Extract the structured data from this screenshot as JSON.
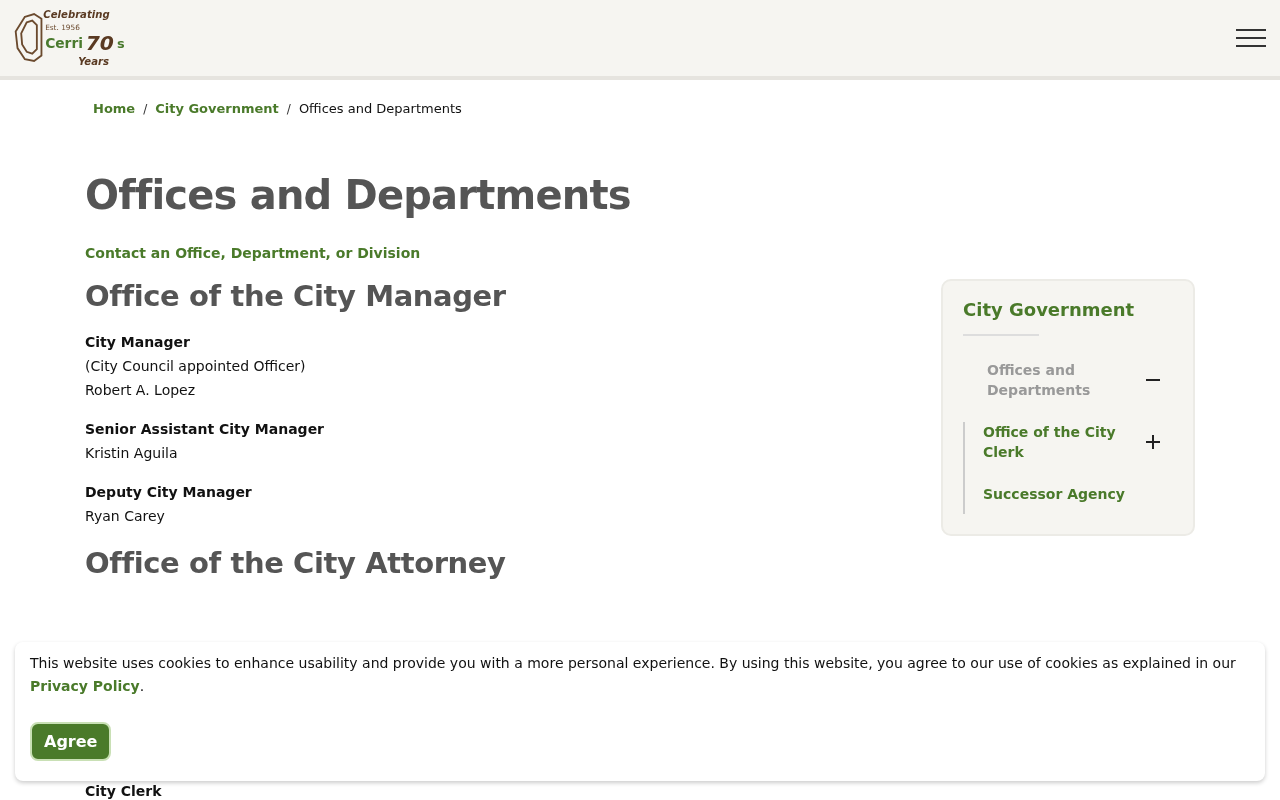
{
  "header": {
    "logo": {
      "top": "Celebrating",
      "est": "Est. 1956",
      "name": "Cerri",
      "number": "70",
      "suffix": "s",
      "bottom": "Years"
    }
  },
  "breadcrumb_separator": "/",
  "breadcrumb": [
    {
      "label": "Home",
      "link": true
    },
    {
      "label": "City Government",
      "link": true
    },
    {
      "label": "Offices and Departments",
      "link": false
    }
  ],
  "page_title": "Offices and Departments",
  "contact_link": "Contact an Office, Department, or Division",
  "sections": [
    {
      "heading": "Office of the City Manager",
      "entries": [
        {
          "role": "City Manager",
          "lines": [
            "(City Council appointed Officer)",
            "Robert A. Lopez"
          ]
        },
        {
          "role": "Senior Assistant City Manager",
          "lines": [
            "Kristin Aguila"
          ]
        },
        {
          "role": "Deputy City Manager",
          "lines": [
            "Ryan Carey"
          ]
        }
      ]
    },
    {
      "heading": "Office of the City Attorney"
    }
  ],
  "partial_text": "City Clerk",
  "sidebar": {
    "title": "City Government",
    "items": [
      {
        "label": "Offices and Departments",
        "selected": true,
        "expanded": true,
        "children": [
          {
            "label": "Office of the City Clerk",
            "selected": false,
            "expanded": false
          },
          {
            "label": "Successor Agency",
            "selected": false
          }
        ]
      }
    ]
  },
  "cookie_banner": {
    "text_before": "This website uses cookies to enhance usability and provide you with a more personal experience. By using this website, you agree to our use of cookies as explained in our ",
    "link": "Privacy Policy",
    "text_after": ".",
    "button": "Agree"
  }
}
